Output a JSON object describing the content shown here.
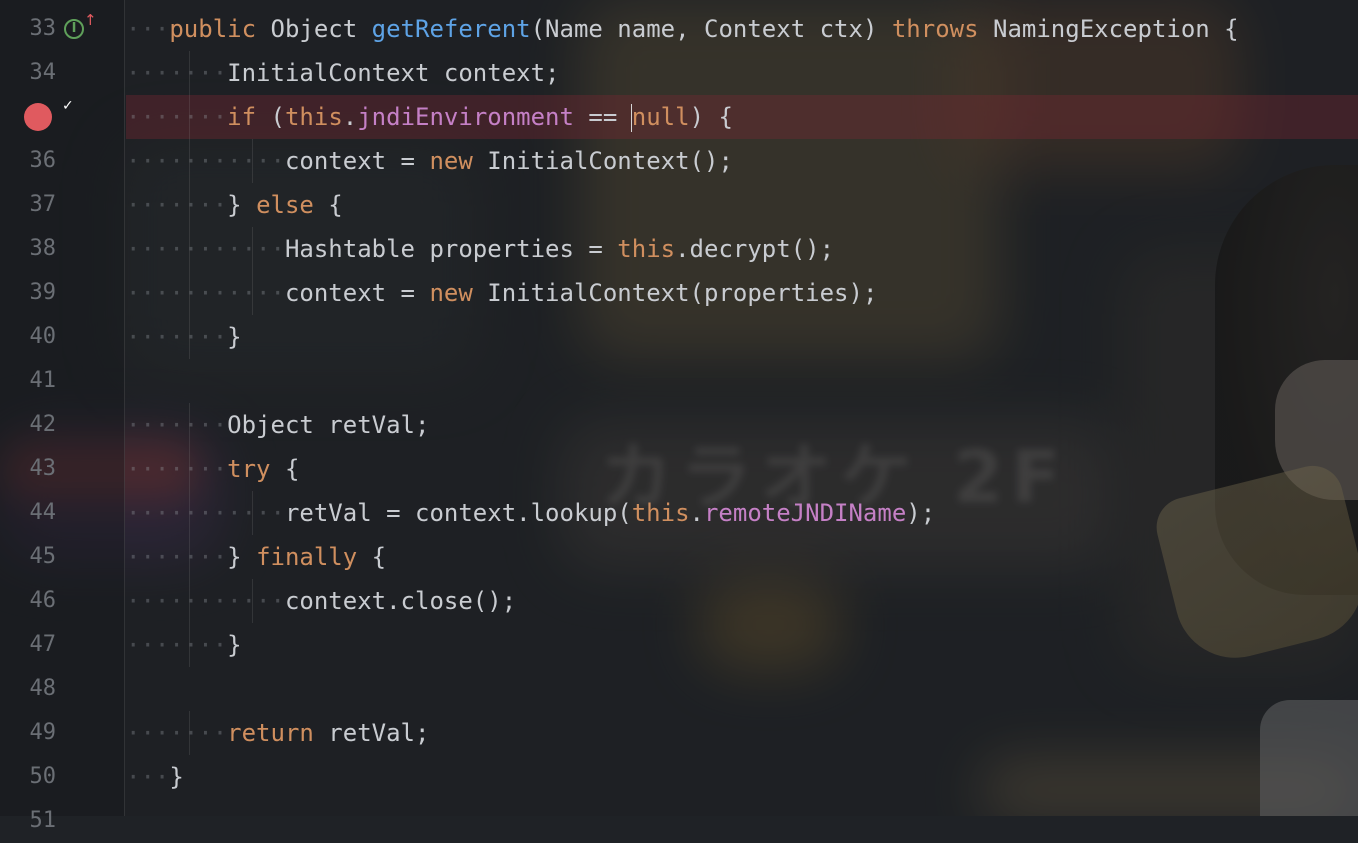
{
  "editor": {
    "line_numbers": [
      "33",
      "34",
      "35",
      "36",
      "37",
      "38",
      "39",
      "40",
      "41",
      "42",
      "43",
      "44",
      "45",
      "46",
      "47",
      "48",
      "49",
      "50",
      "51"
    ],
    "breakpoint_line": "35",
    "lines": [
      {
        "lead": "···",
        "tokens": [
          {
            "t": "public",
            "c": "kw"
          },
          {
            "t": " Object ",
            "c": "plain"
          },
          {
            "t": "getReferent",
            "c": "fn"
          },
          {
            "t": "(Name name, Context ctx) ",
            "c": "plain"
          },
          {
            "t": "throws",
            "c": "kw"
          },
          {
            "t": " NamingException {",
            "c": "plain"
          }
        ]
      },
      {
        "lead": "·······",
        "tokens": [
          {
            "t": "InitialContext context;",
            "c": "plain"
          }
        ]
      },
      {
        "lead": "·······",
        "tokens": [
          {
            "t": "if",
            "c": "kw"
          },
          {
            "t": " (",
            "c": "plain"
          },
          {
            "t": "this",
            "c": "kw"
          },
          {
            "t": ".",
            "c": "plain"
          },
          {
            "t": "jndiEnvironment",
            "c": "field"
          },
          {
            "t": " == ",
            "c": "plain"
          },
          {
            "t": "null",
            "c": "kw"
          },
          {
            "t": ") {",
            "c": "plain"
          }
        ]
      },
      {
        "lead": "···········",
        "tokens": [
          {
            "t": "context = ",
            "c": "plain"
          },
          {
            "t": "new",
            "c": "kw"
          },
          {
            "t": " InitialContext();",
            "c": "plain"
          }
        ]
      },
      {
        "lead": "·······",
        "tokens": [
          {
            "t": "} ",
            "c": "plain"
          },
          {
            "t": "else",
            "c": "kw"
          },
          {
            "t": " {",
            "c": "plain"
          }
        ]
      },
      {
        "lead": "···········",
        "tokens": [
          {
            "t": "Hashtable properties = ",
            "c": "plain"
          },
          {
            "t": "this",
            "c": "kw"
          },
          {
            "t": ".decrypt();",
            "c": "plain"
          }
        ]
      },
      {
        "lead": "···········",
        "tokens": [
          {
            "t": "context = ",
            "c": "plain"
          },
          {
            "t": "new",
            "c": "kw"
          },
          {
            "t": " InitialContext(properties);",
            "c": "plain"
          }
        ]
      },
      {
        "lead": "·······",
        "tokens": [
          {
            "t": "}",
            "c": "plain"
          }
        ]
      },
      {
        "lead": "",
        "tokens": []
      },
      {
        "lead": "·······",
        "tokens": [
          {
            "t": "Object retVal;",
            "c": "plain"
          }
        ]
      },
      {
        "lead": "·······",
        "tokens": [
          {
            "t": "try",
            "c": "kw"
          },
          {
            "t": " {",
            "c": "plain"
          }
        ]
      },
      {
        "lead": "···········",
        "tokens": [
          {
            "t": "retVal = context.lookup(",
            "c": "plain"
          },
          {
            "t": "this",
            "c": "kw"
          },
          {
            "t": ".",
            "c": "plain"
          },
          {
            "t": "remoteJNDIName",
            "c": "field"
          },
          {
            "t": ");",
            "c": "plain"
          }
        ]
      },
      {
        "lead": "·······",
        "tokens": [
          {
            "t": "} ",
            "c": "plain"
          },
          {
            "t": "finally",
            "c": "kw"
          },
          {
            "t": " {",
            "c": "plain"
          }
        ]
      },
      {
        "lead": "···········",
        "tokens": [
          {
            "t": "context.close();",
            "c": "plain"
          }
        ]
      },
      {
        "lead": "·······",
        "tokens": [
          {
            "t": "}",
            "c": "plain"
          }
        ]
      },
      {
        "lead": "",
        "tokens": []
      },
      {
        "lead": "·······",
        "tokens": [
          {
            "t": "return",
            "c": "kw"
          },
          {
            "t": " retVal;",
            "c": "plain"
          }
        ]
      },
      {
        "lead": "···",
        "tokens": [
          {
            "t": "}",
            "c": "plain"
          }
        ]
      },
      {
        "lead": "",
        "tokens": []
      }
    ]
  },
  "gutter_icons": {
    "implements_icon_letter": "I",
    "implements_arrow": "↑",
    "breakpoint_check": "✓"
  },
  "background": {
    "sign_text": "カラオケ 2F"
  },
  "colors": {
    "keyword": "#d08f5f",
    "method": "#5ea3e6",
    "field": "#c580c6",
    "text": "#c9ccd1",
    "line_number": "#6b6f75",
    "breakpoint": "#e05a5f"
  }
}
